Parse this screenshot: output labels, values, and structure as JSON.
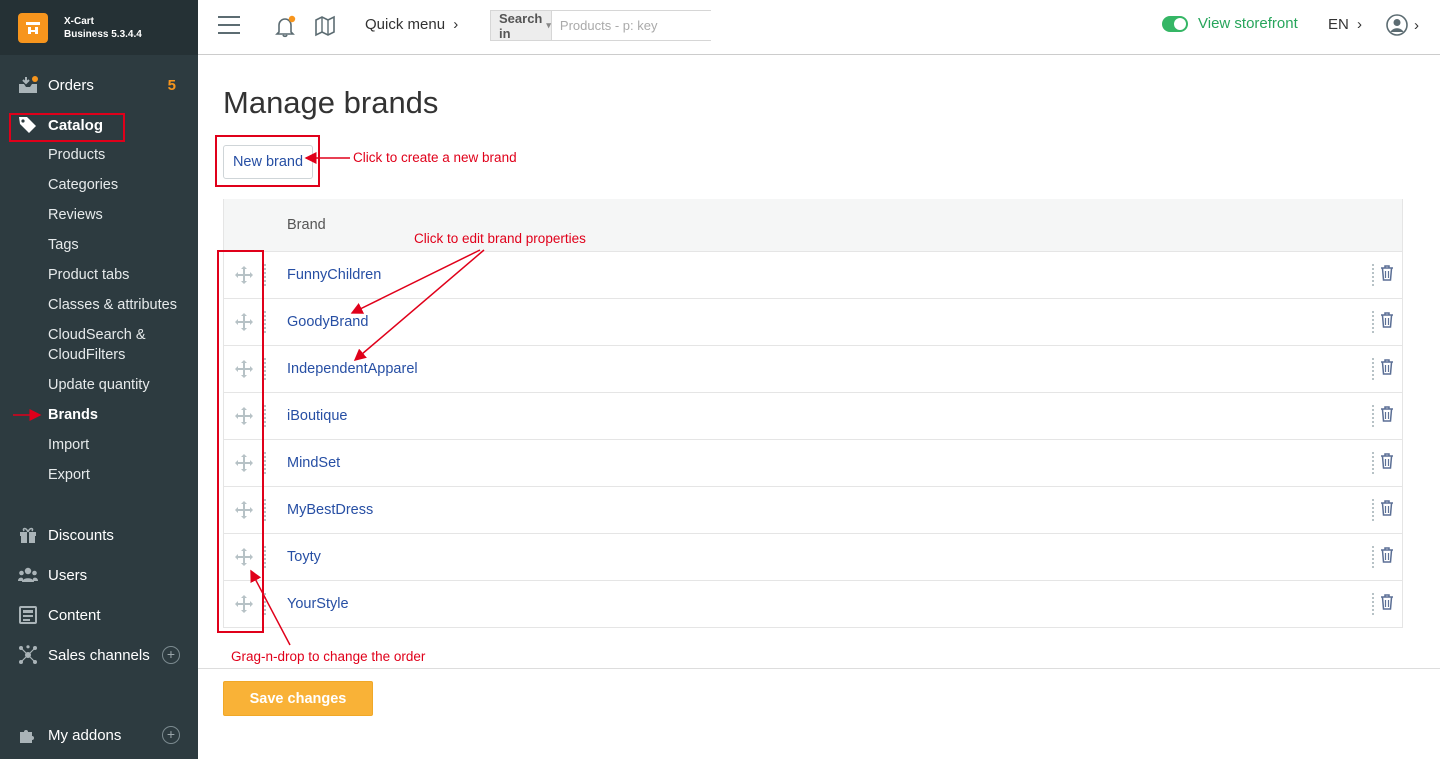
{
  "app": {
    "name": "X-Cart",
    "edition": "Business 5.3.4.4"
  },
  "sidebar": {
    "orders": {
      "label": "Orders",
      "badge": "5"
    },
    "catalog": {
      "label": "Catalog"
    },
    "catalog_items": [
      {
        "label": "Products"
      },
      {
        "label": "Categories"
      },
      {
        "label": "Reviews"
      },
      {
        "label": "Tags"
      },
      {
        "label": "Product tabs"
      },
      {
        "label": "Classes & attributes"
      },
      {
        "label": "CloudSearch &"
      },
      {
        "label": "CloudFilters"
      },
      {
        "label": "Update quantity"
      },
      {
        "label": "Brands"
      },
      {
        "label": "Import"
      },
      {
        "label": "Export"
      }
    ],
    "discounts": {
      "label": "Discounts"
    },
    "users": {
      "label": "Users"
    },
    "content": {
      "label": "Content"
    },
    "sales_channels": {
      "label": "Sales channels"
    },
    "addons": {
      "label": "My addons"
    }
  },
  "topbar": {
    "quick_menu": "Quick menu",
    "search_in": "Search in",
    "search_placeholder": "Products - p: key",
    "view_storefront": "View storefront",
    "language": "EN"
  },
  "main": {
    "title": "Manage brands",
    "new_brand": "New brand",
    "column_brand": "Brand",
    "brands": [
      {
        "name": "FunnyChildren"
      },
      {
        "name": "GoodyBrand"
      },
      {
        "name": "IndependentApparel"
      },
      {
        "name": "iBoutique"
      },
      {
        "name": "MindSet"
      },
      {
        "name": "MyBestDress"
      },
      {
        "name": "Toyty"
      },
      {
        "name": "YourStyle"
      }
    ],
    "save_changes": "Save changes"
  },
  "annotations": {
    "create_brand": "Click to create a new brand",
    "edit_brand": "Click to edit brand properties",
    "drag_order": "Grag-n-drop to change the order"
  },
  "colors": {
    "sidebar_bg": "#2d3b40",
    "accent": "#f7951d",
    "link": "#274fa4",
    "annotation": "#e0001a",
    "save_button": "#f9b237",
    "storefront": "#27a55b"
  }
}
